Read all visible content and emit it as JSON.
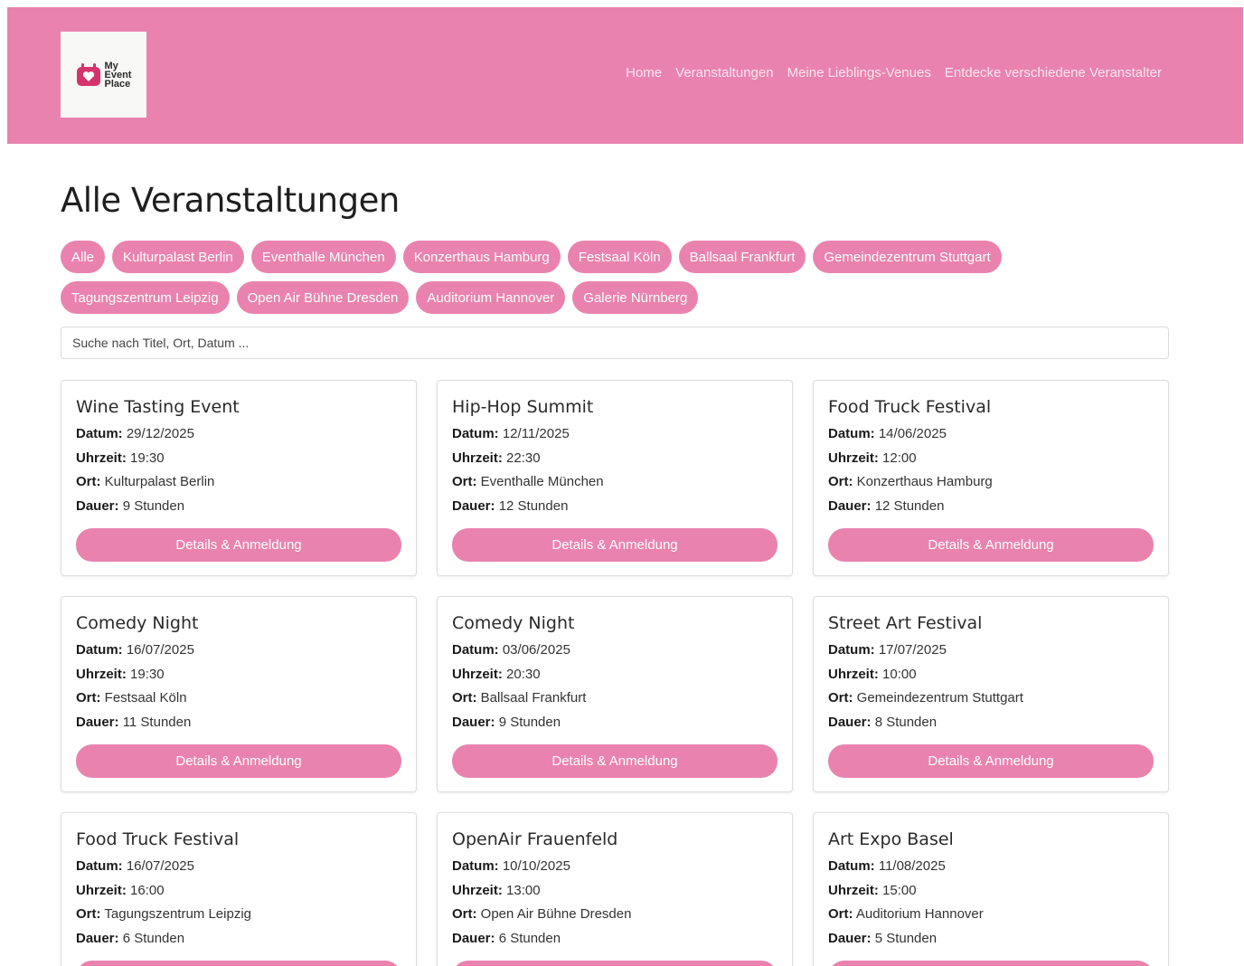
{
  "header": {
    "logo_text": [
      "My",
      "Event",
      "Place"
    ],
    "nav": [
      "Home",
      "Veranstaltungen",
      "Meine Lieblings-Venues",
      "Entdecke verschiedene Veranstalter"
    ]
  },
  "page_title": "Alle Veranstaltungen",
  "filters": {
    "row1": [
      "Alle",
      "Kulturpalast Berlin",
      "Eventhalle München",
      "Konzerthaus Hamburg",
      "Festsaal Köln",
      "Ballsaal Frankfurt",
      "Gemeindezentrum Stuttgart"
    ],
    "row2": [
      "Tagungszentrum Leipzig",
      "Open Air Bühne Dresden",
      "Auditorium Hannover",
      "Galerie Nürnberg"
    ]
  },
  "search": {
    "placeholder": "Suche nach Titel, Ort, Datum ..."
  },
  "labels": {
    "date": "Datum:",
    "time": "Uhrzeit:",
    "place": "Ort:",
    "duration": "Dauer:",
    "button": "Details & Anmeldung"
  },
  "events": [
    {
      "title": "Wine Tasting Event",
      "date": "29/12/2025",
      "time": "19:30",
      "place": "Kulturpalast Berlin",
      "duration": "9 Stunden"
    },
    {
      "title": "Hip-Hop Summit",
      "date": "12/11/2025",
      "time": "22:30",
      "place": "Eventhalle München",
      "duration": "12 Stunden"
    },
    {
      "title": "Food Truck Festival",
      "date": "14/06/2025",
      "time": "12:00",
      "place": "Konzerthaus Hamburg",
      "duration": "12 Stunden"
    },
    {
      "title": "Comedy Night",
      "date": "16/07/2025",
      "time": "19:30",
      "place": "Festsaal Köln",
      "duration": "11 Stunden"
    },
    {
      "title": "Comedy Night",
      "date": "03/06/2025",
      "time": "20:30",
      "place": "Ballsaal Frankfurt",
      "duration": "9 Stunden"
    },
    {
      "title": "Street Art Festival",
      "date": "17/07/2025",
      "time": "10:00",
      "place": "Gemeindezentrum Stuttgart",
      "duration": "8 Stunden"
    },
    {
      "title": "Food Truck Festival",
      "date": "16/07/2025",
      "time": "16:00",
      "place": "Tagungszentrum Leipzig",
      "duration": "6 Stunden"
    },
    {
      "title": "OpenAir Frauenfeld",
      "date": "10/10/2025",
      "time": "13:00",
      "place": "Open Air Bühne Dresden",
      "duration": "6 Stunden"
    },
    {
      "title": "Art Expo Basel",
      "date": "11/08/2025",
      "time": "15:00",
      "place": "Auditorium Hannover",
      "duration": "5 Stunden"
    }
  ]
}
